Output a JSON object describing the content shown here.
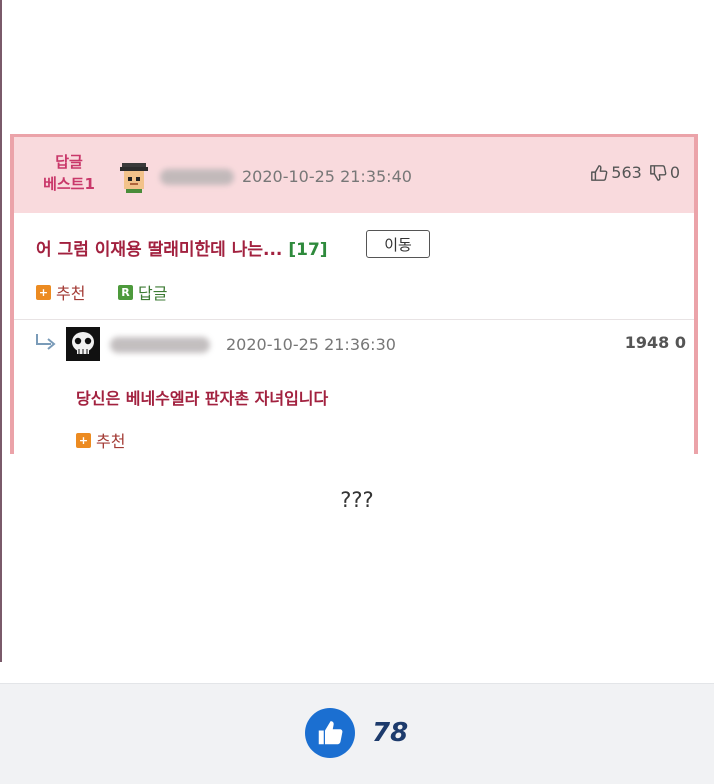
{
  "post": {
    "best_label_line1": "답글",
    "best_label_line2": "베스트1",
    "date": "2020-10-25 21:35:40",
    "up_count": "563",
    "down_count": "0",
    "title": "어 그럼 이재용 딸래미한데 나는...",
    "comment_count": "[17]",
    "move_button": "이동",
    "recommend_label": "추천",
    "reply_label": "답글",
    "reply_badge": "R",
    "recommend_badge": "+"
  },
  "reply": {
    "date": "2020-10-25 21:36:30",
    "score": "1948 0",
    "text": "당신은 베네수엘라 판자촌 자녀입니다",
    "recommend_label": "추천",
    "recommend_badge": "+"
  },
  "caption": "???",
  "bottom": {
    "like_count": "78"
  },
  "colors": {
    "card_border": "#eba3a9",
    "header_bg": "#f9dadd",
    "title_red": "#a2213f",
    "like_blue": "#1b6fd1"
  }
}
